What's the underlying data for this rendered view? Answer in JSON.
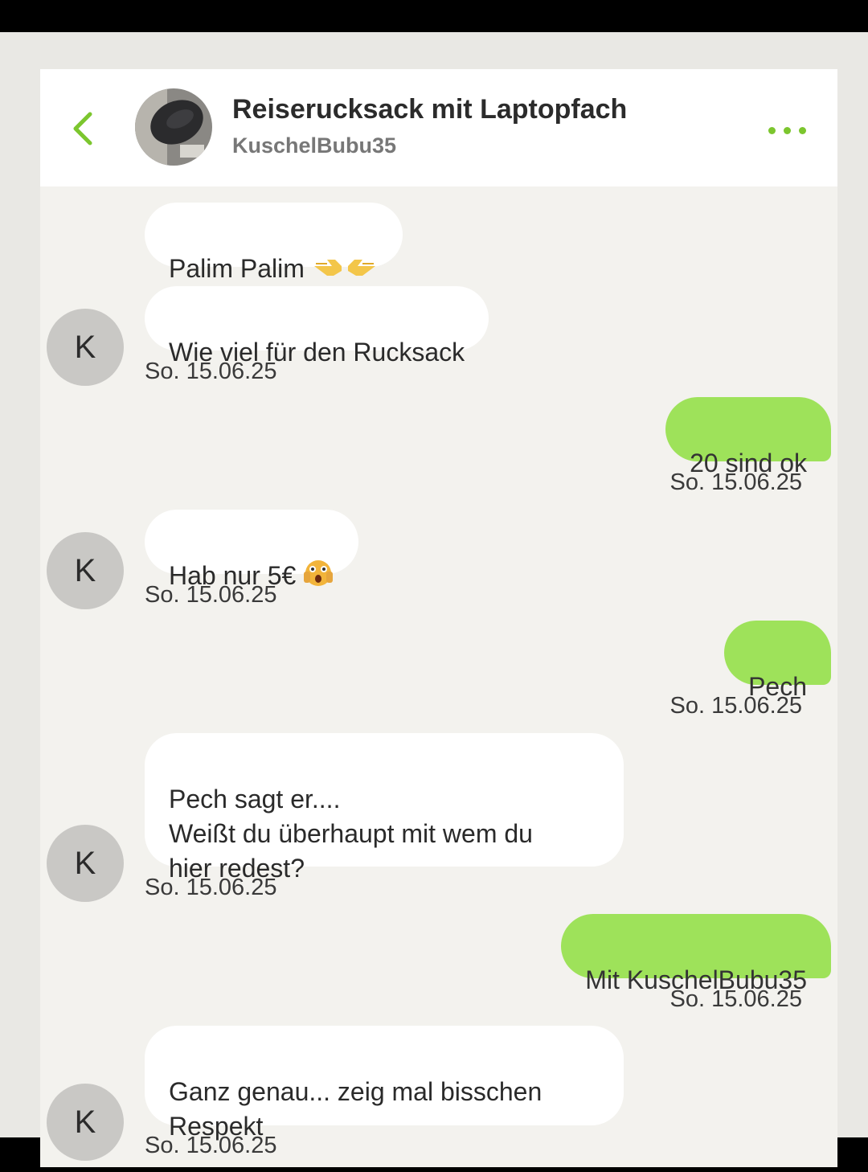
{
  "header": {
    "title": "Reiserucksack mit Laptopfach",
    "subtitle": "KuschelBubu35"
  },
  "avatar_letter": "K",
  "accent_color": "#7cc62e",
  "outgoing_bubble_color": "#9ee25a",
  "messages": [
    {
      "side": "in",
      "text": "Palim Palim",
      "emoji": "pointing-hands-icon"
    },
    {
      "side": "in",
      "text": "Wie viel für den Rucksack",
      "time": "So. 15.06.25"
    },
    {
      "side": "out",
      "text": "20 sind ok",
      "time": "So. 15.06.25"
    },
    {
      "side": "in",
      "text": "Hab nur 5€",
      "emoji": "shocked-face-icon",
      "time": "So. 15.06.25"
    },
    {
      "side": "out",
      "text": "Pech",
      "time": "So. 15.06.25"
    },
    {
      "side": "in",
      "text": "Pech sagt er....\nWeißt du überhaupt mit wem du\nhier redest?",
      "time": "So. 15.06.25"
    },
    {
      "side": "out",
      "text": "Mit KuschelBubu35",
      "time": "So. 15.06.25"
    },
    {
      "side": "in",
      "text": "Ganz genau... zeig mal bisschen\nRespekt",
      "time": "So. 15.06.25"
    }
  ]
}
